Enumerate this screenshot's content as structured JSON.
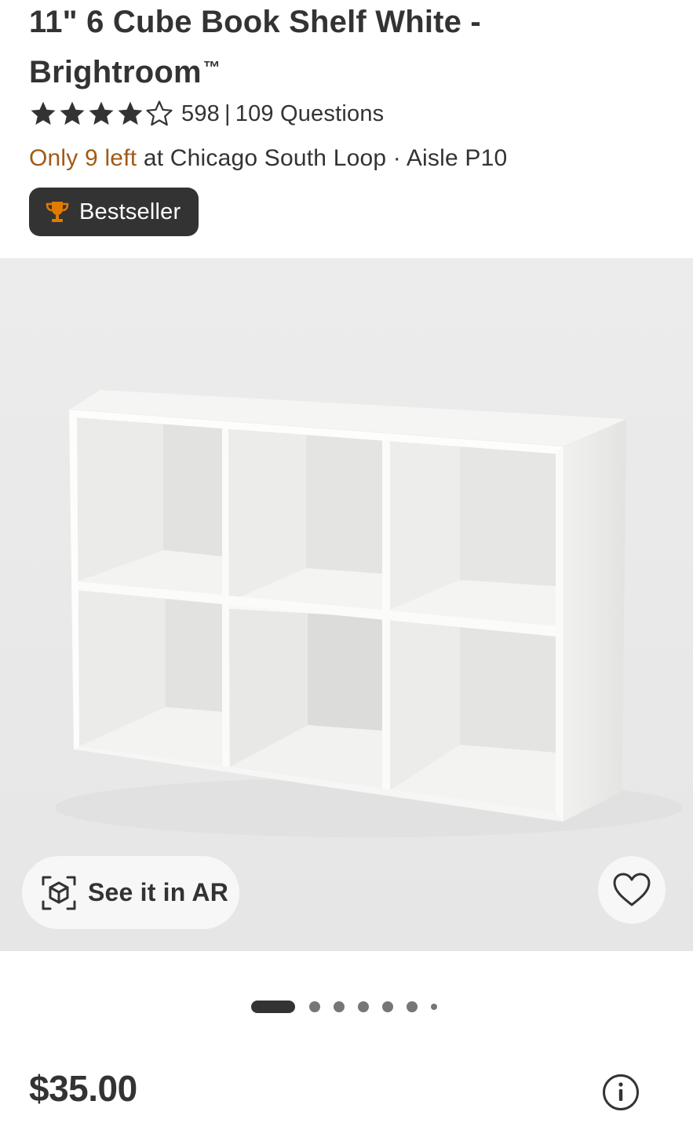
{
  "product": {
    "title_line1": "11\" 6 Cube Book Shelf White -",
    "title_line2": "Brightroom",
    "trademark": "™",
    "rating": 4,
    "rating_max": 5,
    "review_count": "598",
    "questions": "109 Questions",
    "stock_low": "Only 9 left",
    "stock_location": "at Chicago South Loop · Aisle P10",
    "badge": "Bestseller",
    "price": "$35.00"
  },
  "media": {
    "ar_button_label": "See it in AR",
    "image_count": 7,
    "active_image": 1
  },
  "icons": {
    "star_filled": "star-icon",
    "star_empty": "star-outline-icon",
    "trophy": "trophy-icon",
    "ar": "ar-cube-icon",
    "favorite": "heart-icon",
    "info": "info-icon"
  },
  "colors": {
    "text": "#333333",
    "low_stock": "#a25a14",
    "trophy": "#e07b00",
    "image_bg": "#ececec"
  }
}
